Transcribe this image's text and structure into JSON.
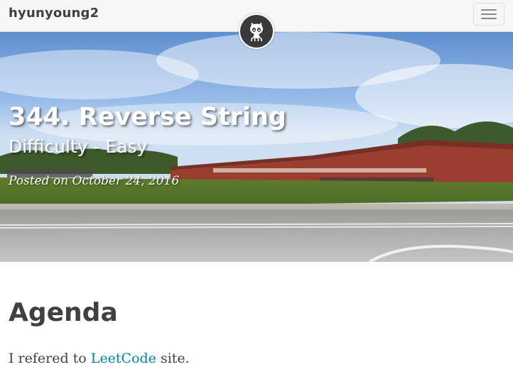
{
  "navbar": {
    "brand": "hyunyoung2",
    "avatar_icon": "github-octocat-icon",
    "menu_icon": "hamburger-menu-icon"
  },
  "header": {
    "title": "344. Reverse String",
    "subtitle": "Difficulty - Easy",
    "meta_prefix": "Posted on",
    "meta_date": "October 24, 2016"
  },
  "content": {
    "heading": "Agenda",
    "para_before": "I refered to ",
    "link_text": "LeetCode",
    "para_after": " site."
  },
  "colors": {
    "link": "#0085a1",
    "text": "#404040",
    "navbar_bg": "#f7f7f7"
  }
}
